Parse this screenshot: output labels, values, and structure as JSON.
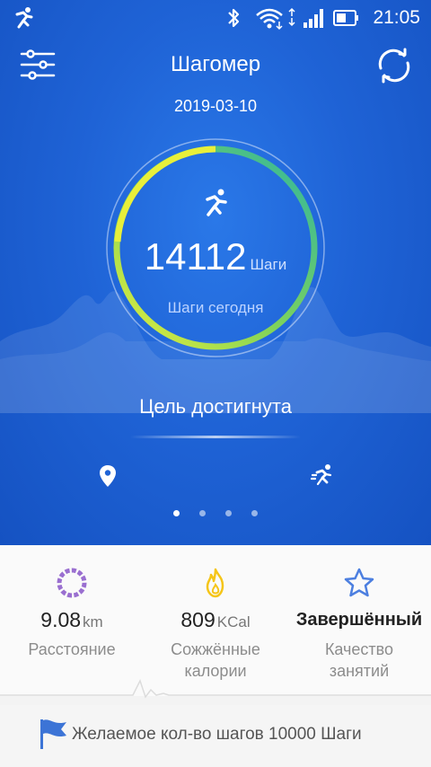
{
  "status_bar": {
    "time": "21:05"
  },
  "header": {
    "title": "Шагомер"
  },
  "date": "2019-03-10",
  "steps": {
    "count": "14112",
    "unit": "Шаги",
    "subtitle": "Шаги сегодня",
    "progress_fraction": 1.0
  },
  "goal_status": "Цель достигнута",
  "pager": {
    "pages": 4,
    "active": 0
  },
  "stats": {
    "distance": {
      "value": "9.08",
      "unit": "km",
      "label": "Расстояние"
    },
    "calories": {
      "value": "809",
      "unit": "KCal",
      "label": "Сожжённые калории"
    },
    "quality": {
      "value": "Завершённый",
      "label": "Качество занятий"
    }
  },
  "footer": {
    "text": "Желаемое кол-во шагов 10000 Шаги"
  },
  "colors": {
    "accent_blue": "#1f63d6",
    "ring_start": "#e8ef3a",
    "ring_end": "#2fb5a0",
    "calorie_icon": "#f5c518",
    "distance_icon": "#9a6fd0",
    "quality_icon": "#4c7fe0"
  }
}
